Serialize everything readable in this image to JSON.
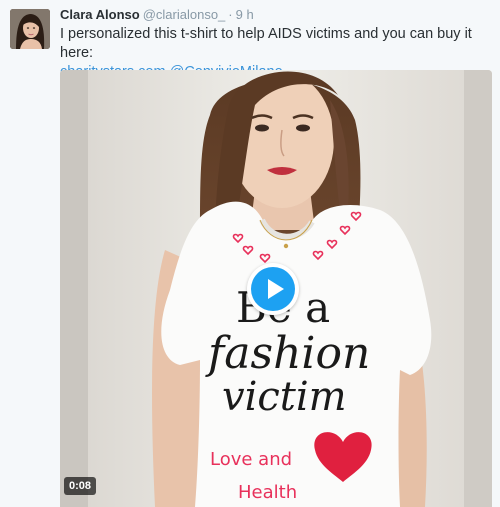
{
  "tweet": {
    "author": {
      "display_name": "Clara Alonso",
      "handle": "@clarialonso_",
      "separator": "·",
      "time": "9 h"
    },
    "text_parts": {
      "body": "I personalized this t-shirt to help AIDS victims and you can buy it here:",
      "link_1": "charitystars.com",
      "link_2": "@ConvivioMilano"
    },
    "media": {
      "type": "video",
      "duration": "0:08",
      "shirt_text": {
        "line_1": "Be a",
        "line_2": "fashion",
        "line_3": "victim",
        "handwritten_1": "Love and",
        "handwritten_2": "Health"
      },
      "colors": {
        "play_icon": "#1da1f2",
        "shirt": "#fbfbfa",
        "hearts": "#e8315b"
      }
    }
  }
}
